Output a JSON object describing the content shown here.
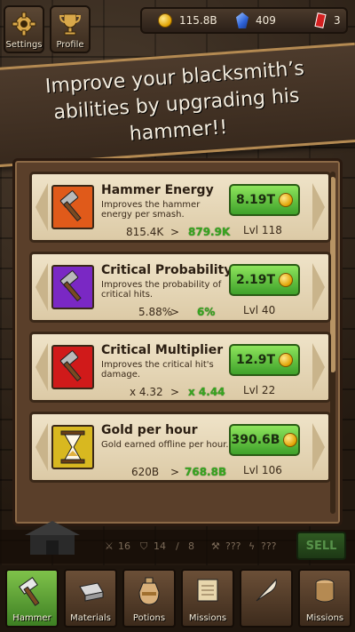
{
  "topbar": {
    "settings_label": "Settings",
    "profile_label": "Profile"
  },
  "currency": {
    "gold": "115.8B",
    "gems": "409",
    "tickets": "3"
  },
  "banner": {
    "text": "Improve your blacksmith’s abilities by upgrading his hammer!!"
  },
  "upgrades": [
    {
      "title": "Hammer Energy",
      "description": "Improves the hammer energy per smash.",
      "current": "815.4K",
      "sep": ">",
      "next": "879.9K",
      "price": "8.19T",
      "level": "Lvl 118",
      "icon": "hammer-icon",
      "color": "#e05a1a"
    },
    {
      "title": "Critical Probability",
      "description": "Improves the probability of critical hits.",
      "current": "5.88%",
      "sep": ">",
      "next": "6%",
      "price": "2.19T",
      "level": "Lvl 40",
      "icon": "hammer-icon",
      "color": "#7a28c4"
    },
    {
      "title": "Critical Multiplier",
      "description": "Improves the critical hit's damage.",
      "current": "x 4.32",
      "sep": ">",
      "next": "x 4.44",
      "price": "12.9T",
      "level": "Lvl 22",
      "icon": "hammer-icon",
      "color": "#d01a1a"
    },
    {
      "title": "Gold per hour",
      "description": "Gold earned offline per hour.",
      "current": "620B",
      "sep": ">",
      "next": "768.8B",
      "price": "390.6B",
      "level": "Lvl 106",
      "icon": "hourglass-icon",
      "color": "#d8b820"
    }
  ],
  "stats": [
    "16",
    "14",
    "8",
    "???",
    "???"
  ],
  "sell_label": "SELL",
  "nav": [
    {
      "label": "Hammer",
      "icon": "hammer-icon"
    },
    {
      "label": "Materials",
      "icon": "ingot-icon"
    },
    {
      "label": "Potions",
      "icon": "potion-icon"
    },
    {
      "label": "Missions",
      "icon": "scroll-icon"
    },
    {
      "label": "",
      "icon": "quill-icon"
    },
    {
      "label": "Missions",
      "icon": "barrel-icon"
    }
  ]
}
